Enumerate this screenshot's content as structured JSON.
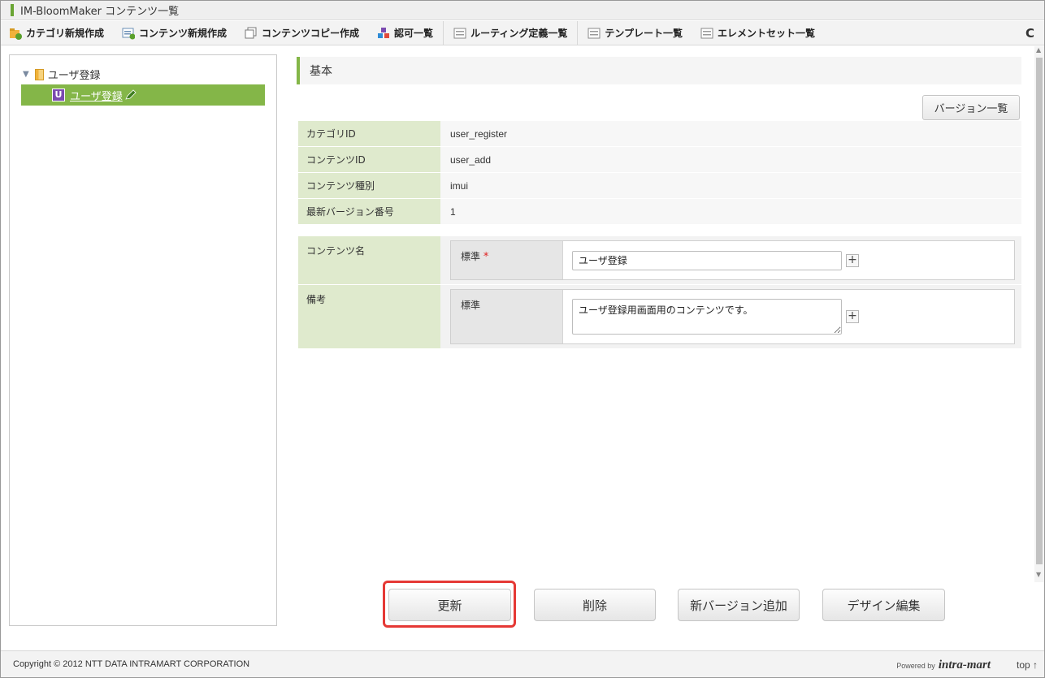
{
  "window": {
    "title": "IM-BloomMaker コンテンツ一覧"
  },
  "toolbar": {
    "items": [
      {
        "label": "カテゴリ新規作成",
        "icon": "folder-add-icon"
      },
      {
        "label": "コンテンツ新規作成",
        "icon": "content-add-icon"
      },
      {
        "label": "コンテンツコピー作成",
        "icon": "copy-icon"
      },
      {
        "label": "認可一覧",
        "icon": "blocks-icon"
      },
      {
        "label": "ルーティング定義一覧",
        "icon": "list-icon"
      },
      {
        "label": "テンプレート一覧",
        "icon": "list-icon"
      },
      {
        "label": "エレメントセット一覧",
        "icon": "list-icon"
      }
    ],
    "refresh_glyph": "C"
  },
  "tree": {
    "root_label": "ユーザ登録",
    "selected_badge": "U",
    "selected_label": "ユーザ登録"
  },
  "section": {
    "title": "基本"
  },
  "version_list_button": "バージョン一覧",
  "info": [
    {
      "key": "カテゴリID",
      "value": "user_register"
    },
    {
      "key": "コンテンツID",
      "value": "user_add"
    },
    {
      "key": "コンテンツ種別",
      "value": "imui"
    },
    {
      "key": "最新バージョン番号",
      "value": "1"
    }
  ],
  "form": {
    "content_name": {
      "label": "コンテンツ名",
      "locale_label": "標準",
      "required_mark": "*",
      "value": "ユーザ登録"
    },
    "note": {
      "label": "備考",
      "locale_label": "標準",
      "value": "ユーザ登録用画面用のコンテンツです。"
    },
    "plus": "+"
  },
  "buttons": {
    "update": "更新",
    "delete": "削除",
    "new_version": "新バージョン追加",
    "design_edit": "デザイン編集"
  },
  "footer": {
    "copyright": "Copyright © 2012 NTT DATA INTRAMART CORPORATION",
    "powered_by": "Powered by",
    "brand": "intra-mart",
    "top_link": "top ↑"
  },
  "colors": {
    "accent_green": "#84b648",
    "label_bg": "#dfeacd",
    "highlight_red": "#e53935"
  }
}
